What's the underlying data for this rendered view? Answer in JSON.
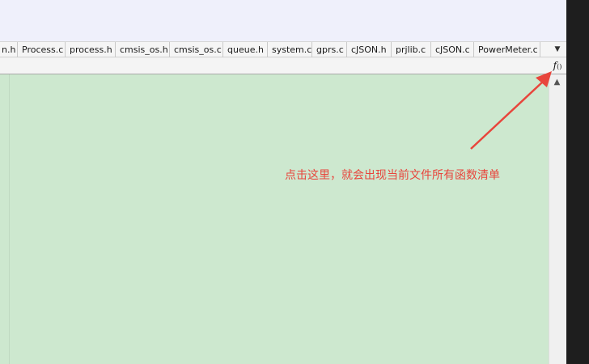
{
  "tabs": [
    {
      "label": "n.h"
    },
    {
      "label": "Process.c"
    },
    {
      "label": "process.h"
    },
    {
      "label": "cmsis_os.h"
    },
    {
      "label": "cmsis_os.c"
    },
    {
      "label": "queue.h"
    },
    {
      "label": "system.c"
    },
    {
      "label": "gprs.c"
    },
    {
      "label": "cJSON.h"
    },
    {
      "label": "prjlib.c"
    },
    {
      "label": "cJSON.c"
    },
    {
      "label": "PowerMeter.c"
    }
  ],
  "toolbar": {
    "tab_list_icon": "▼",
    "function_list_label": "f",
    "function_list_suffix": "()"
  },
  "scrollbar": {
    "up_arrow": "▲"
  },
  "annotation": {
    "text": "点击这里，就会出现当前文件所有函数清单",
    "color": "#e8453c"
  }
}
